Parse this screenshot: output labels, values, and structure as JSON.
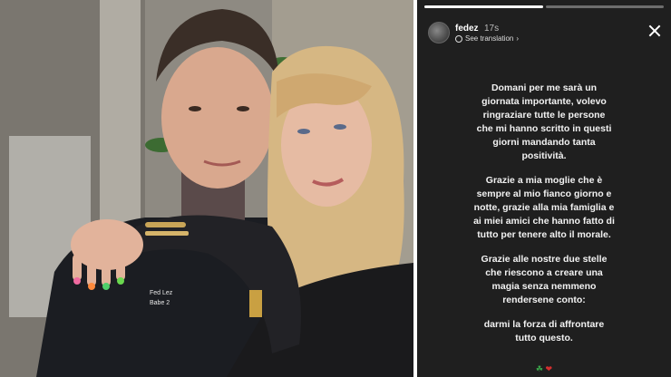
{
  "story": {
    "username": "fedez",
    "time": "17s",
    "translate_label": "See translation",
    "paragraphs": [
      "Domani per me sarà un\ngiornata importante, volevo\nringraziare tutte le persone\nche mi hanno scritto in questi\ngiorni mandando tanta\npositività.",
      "Grazie a mia moglie che è\nsempre al mio fianco giorno e\nnotte, grazie alla mia famiglia e\nai miei amici che hanno fatto di\ntutto per tenere alto il morale.",
      "Grazie alle nostre due stelle\nche riescono a creare una\nmagia senza nemmeno\nrendersene conto:",
      "darmi la forza di affrontare\ntutto questo."
    ],
    "emoji_clover": "☘",
    "emoji_heart": "❤"
  },
  "photo": {
    "shirt_text_1": "Fed Lez",
    "shirt_text_2": "Babe 2"
  },
  "colors": {
    "story_bg": "#1f1f1f",
    "text": "#f2f2f2"
  }
}
